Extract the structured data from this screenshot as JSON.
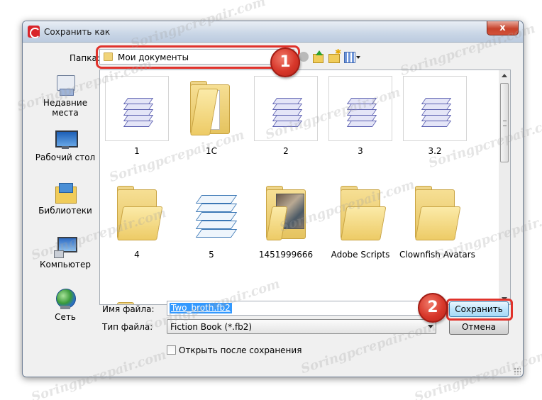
{
  "window": {
    "title": "Сохранить как",
    "close_label": "x"
  },
  "folder": {
    "label": "Папка:",
    "current": "Мои документы"
  },
  "callouts": {
    "one": "1",
    "two": "2"
  },
  "places": [
    {
      "label": "Недавние места",
      "icon": "recent-places-icon"
    },
    {
      "label": "Рабочий стол",
      "icon": "desktop-icon"
    },
    {
      "label": "Библиотеки",
      "icon": "libraries-icon"
    },
    {
      "label": "Компьютер",
      "icon": "computer-icon"
    },
    {
      "label": "Сеть",
      "icon": "network-icon"
    }
  ],
  "files": [
    {
      "label": "1",
      "icon": "document-stack-icon"
    },
    {
      "label": "1C",
      "icon": "folder-icon"
    },
    {
      "label": "2",
      "icon": "document-stack-icon"
    },
    {
      "label": "3",
      "icon": "document-stack-icon"
    },
    {
      "label": "3.2",
      "icon": "document-stack-icon"
    },
    {
      "label": "4",
      "icon": "folder-icon"
    },
    {
      "label": "5",
      "icon": "document-stack-icon"
    },
    {
      "label": "1451999666",
      "icon": "folder-photo-icon"
    },
    {
      "label": "Adobe Scripts",
      "icon": "folder-icon"
    },
    {
      "label": "Clownfish Avatars",
      "icon": "folder-icon"
    }
  ],
  "form": {
    "filename_label": "Имя файла:",
    "filename_value": "Two_broth.fb2",
    "filetype_label": "Тип файла:",
    "filetype_value": "Fiction Book (*.fb2)",
    "open_after_save_label": "Открыть после сохранения",
    "save_label": "Сохранить",
    "cancel_label": "Отмена"
  },
  "watermark": "Soringpcrepair.com"
}
